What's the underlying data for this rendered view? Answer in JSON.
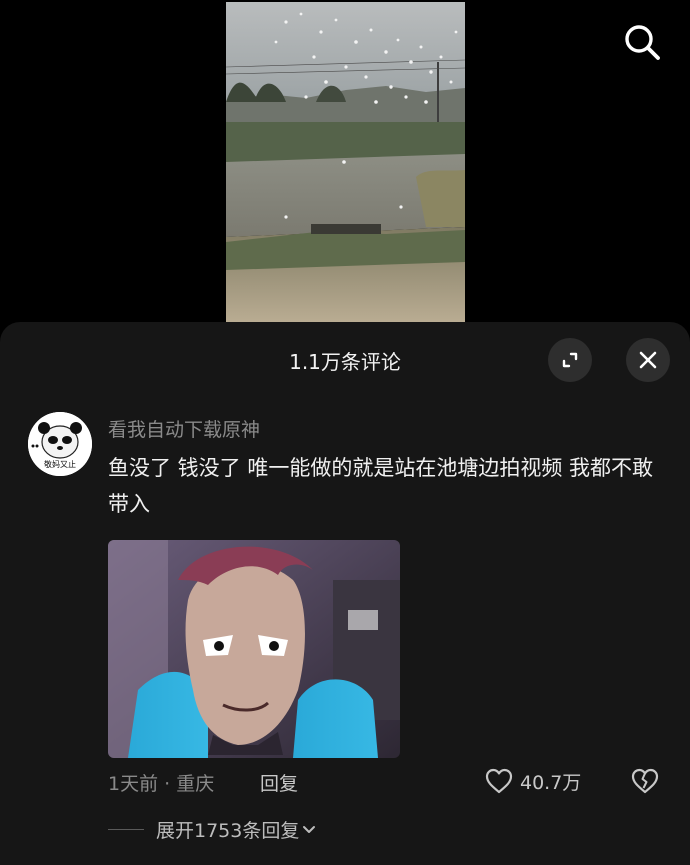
{
  "sheet": {
    "title": "1.1万条评论"
  },
  "comment": {
    "username": "看我自动下载原神",
    "text": "鱼没了 钱没了 唯一能做的就是站在池塘边拍视频 我都不敢带入",
    "avatar_caption": "敬妈又止",
    "meta": "1天前 · 重庆",
    "reply_label": "回复",
    "like_count": "40.7万",
    "expand_replies": "展开1753条回复"
  },
  "icons": {
    "search": "search-icon",
    "expand": "expand-icon",
    "close": "close-icon",
    "like": "heart-outline-icon",
    "dislike": "broken-heart-icon",
    "chevron": "chevron-down-icon"
  },
  "colors": {
    "sheet_bg": "#161616",
    "page_bg": "#000000",
    "muted_text": "#8a8a8a",
    "button_bg": "#2e2e2e"
  }
}
